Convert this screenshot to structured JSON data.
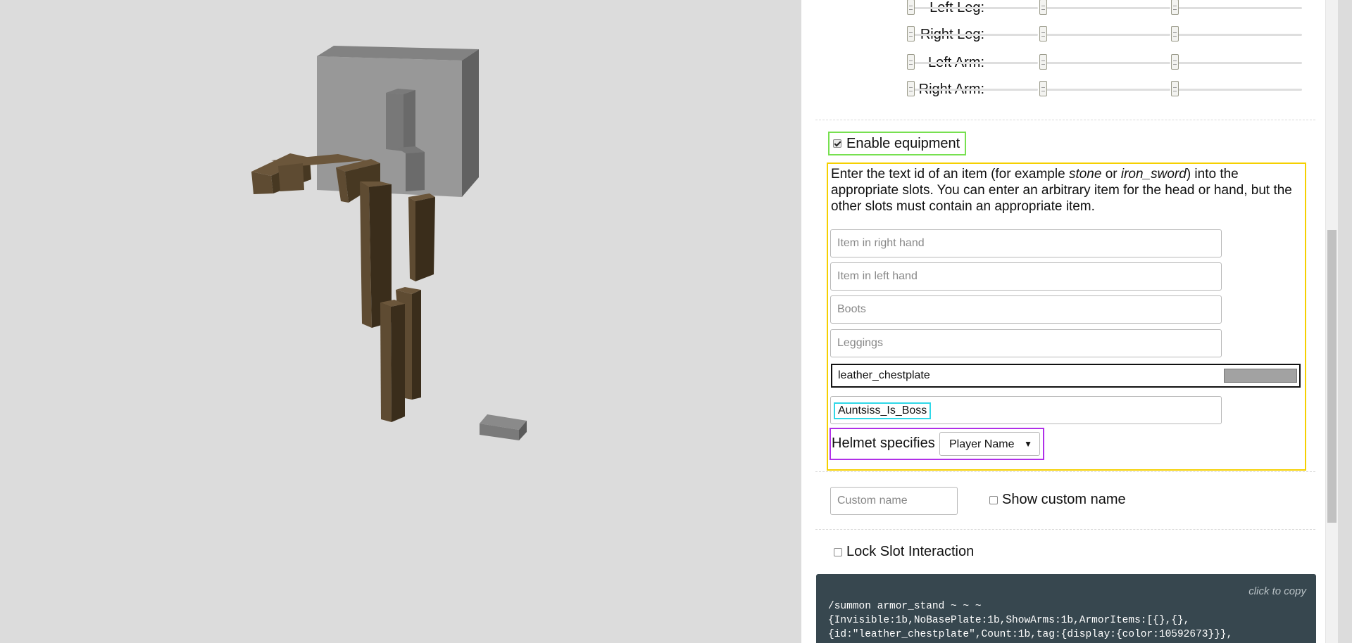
{
  "pose": {
    "rows": [
      {
        "label": "Left Leg:"
      },
      {
        "label": "Right Leg:"
      },
      {
        "label": "Left Arm:"
      },
      {
        "label": "Right Arm:"
      }
    ]
  },
  "equipment": {
    "enable_label": "Enable equipment",
    "enabled": true,
    "help_prefix": "Enter the text id of an item (for example ",
    "help_ex1": "stone",
    "help_or": " or ",
    "help_ex2": "iron_sword",
    "help_suffix": ") into the appropriate slots. You can enter an arbitrary item for the head or hand, but the other slots must contain an appropriate item.",
    "right_hand_placeholder": "Item in right hand",
    "left_hand_placeholder": "Item in left hand",
    "boots_placeholder": "Boots",
    "leggings_placeholder": "Leggings",
    "chestplate_value": "leather_chestplate",
    "chestplate_color": "#a2a2a2",
    "helmet_value": "Auntsiss_Is_Boss",
    "helmet_specifies_label": "Helmet specifies",
    "helmet_specifies_value": "Player Name"
  },
  "custom_name": {
    "placeholder": "Custom name",
    "show_label": "Show custom name",
    "show_checked": false
  },
  "lock_slot": {
    "label": "Lock Slot Interaction",
    "checked": false
  },
  "command": {
    "copy_hint": "click to copy",
    "text": "/summon armor_stand ~ ~ ~\n{Invisible:1b,NoBasePlate:1b,ShowArms:1b,ArmorItems:[{},{},\n{id:\"leather_chestplate\",Count:1b,tag:{display:{color:10592673}}},"
  },
  "colors": {
    "wood": "#5e4b32",
    "equipment_border": "#77e050",
    "helmet_border": "#30d8e8",
    "helmet_spec_border": "#b030e8",
    "slots_border": "#f5d000",
    "command_bg": "#37474f"
  }
}
